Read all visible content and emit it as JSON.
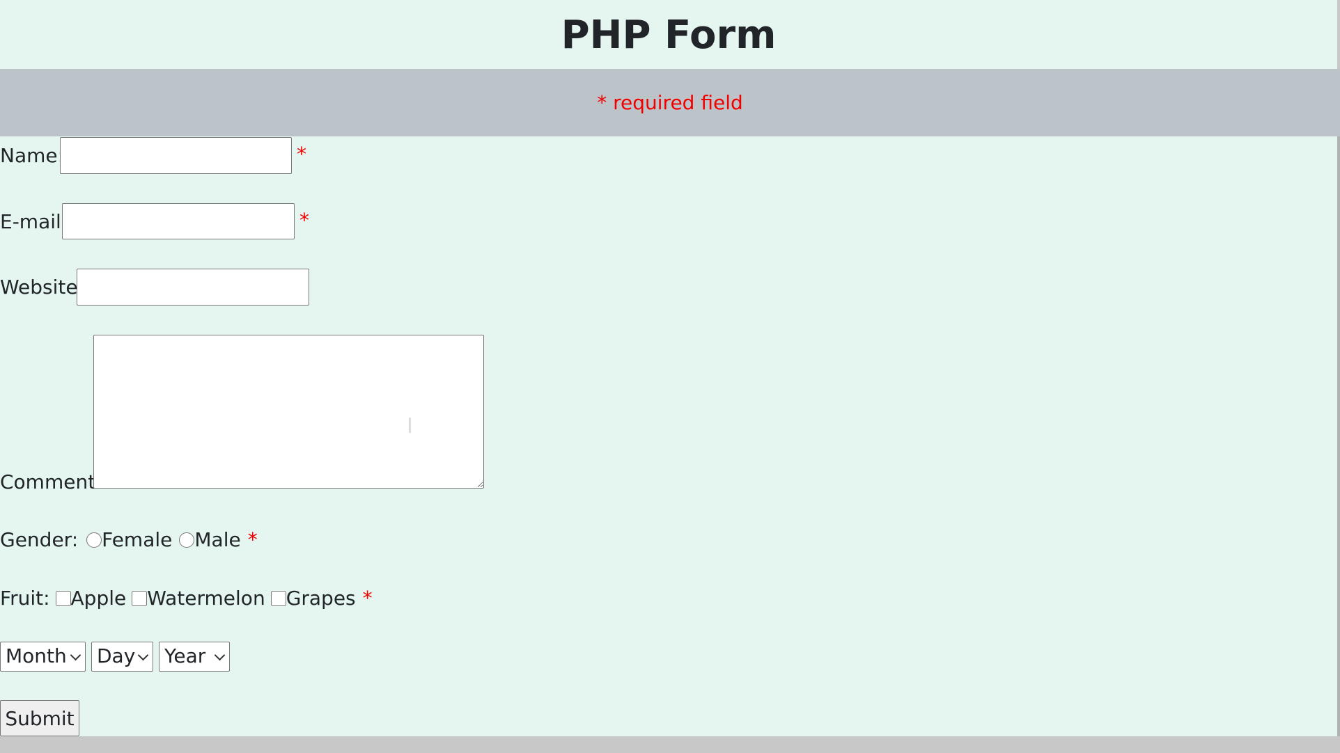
{
  "page": {
    "title": "PHP Form",
    "required_note": "* required field"
  },
  "form": {
    "name_label": "Name:",
    "email_label": "E-mail:",
    "website_label": "Website:",
    "comment_label": "Comment:",
    "required_star": "*",
    "name_value": "",
    "email_value": "",
    "website_value": "",
    "comment_value": "",
    "gender": {
      "label": "Gender:",
      "options": [
        "Female",
        "Male"
      ]
    },
    "fruit": {
      "label": "Fruit:",
      "options": [
        "Apple",
        "Watermelon",
        "Grapes"
      ]
    },
    "date": {
      "month": "Month",
      "day": "Day",
      "year": "Year"
    },
    "submit_label": "Submit"
  },
  "colors": {
    "page_bg": "#e5f6f0",
    "band_bg": "#bcc4ca",
    "required_red": "#f20000"
  }
}
